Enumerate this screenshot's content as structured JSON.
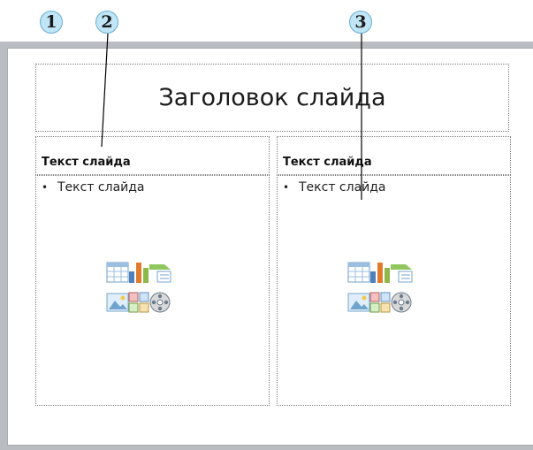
{
  "callouts": [
    "1",
    "2",
    "3"
  ],
  "slide": {
    "title": "Заголовок слайда",
    "left_column": {
      "heading": "Текст слайда",
      "bullet": "Текст слайда"
    },
    "right_column": {
      "heading": "Текст слайда",
      "bullet": "Текст слайда"
    },
    "bullet_glyph": "•"
  },
  "content_icons": [
    "table-icon",
    "chart-icon",
    "smartart-icon",
    "picture-icon",
    "clipart-icon",
    "media-icon"
  ]
}
